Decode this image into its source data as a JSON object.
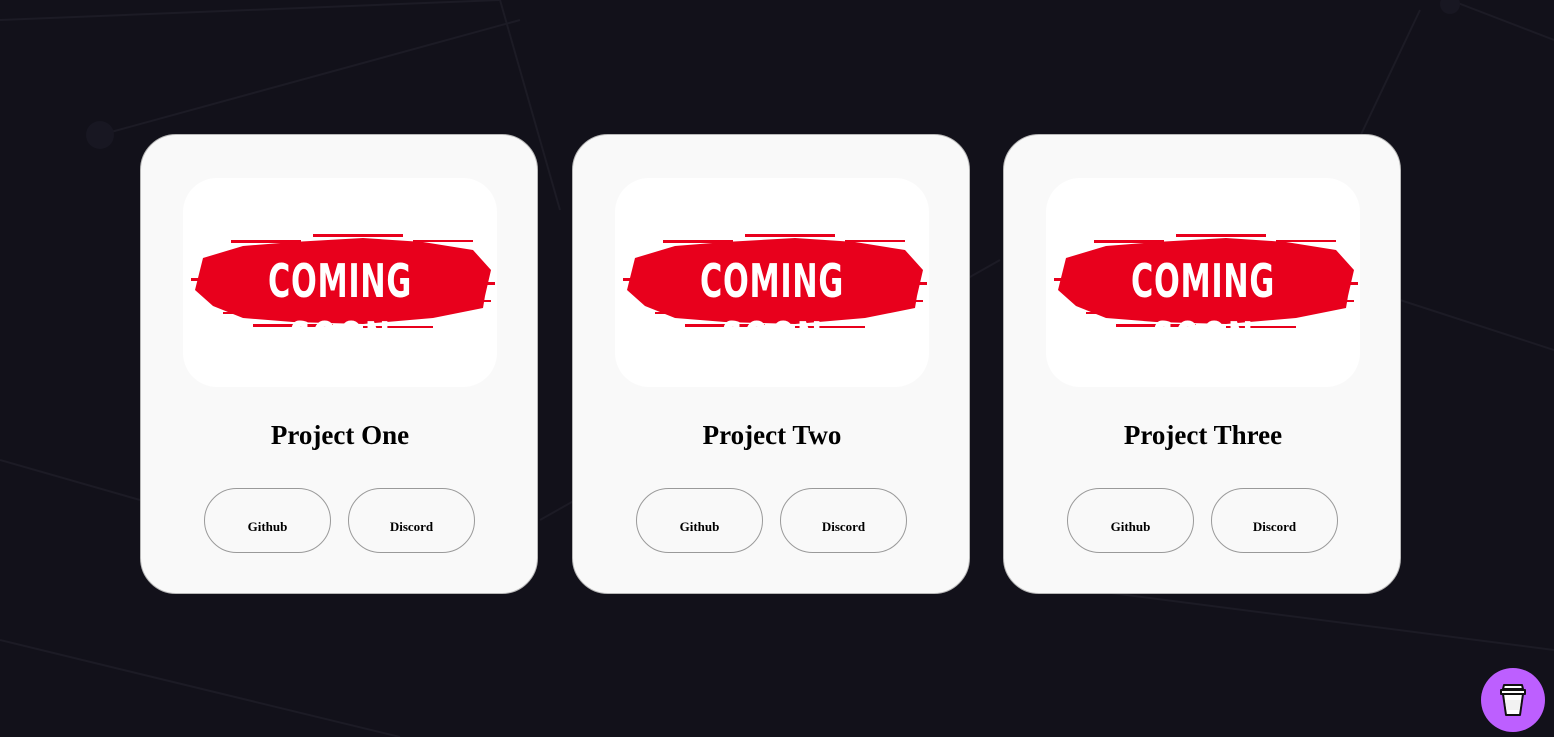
{
  "projects": [
    {
      "title": "Project One",
      "image_text": "COMING SOON",
      "github_label": "Github",
      "discord_label": "Discord"
    },
    {
      "title": "Project Two",
      "image_text": "COMING SOON",
      "github_label": "Github",
      "discord_label": "Discord"
    },
    {
      "title": "Project Three",
      "image_text": "COMING SOON",
      "github_label": "Github",
      "discord_label": "Discord"
    }
  ],
  "colors": {
    "background": "#12111a",
    "card": "#f9f9f9",
    "brush_red": "#e8001c",
    "coffee_button": "#bd5fff"
  },
  "floating_button": {
    "icon": "coffee-cup-icon"
  }
}
